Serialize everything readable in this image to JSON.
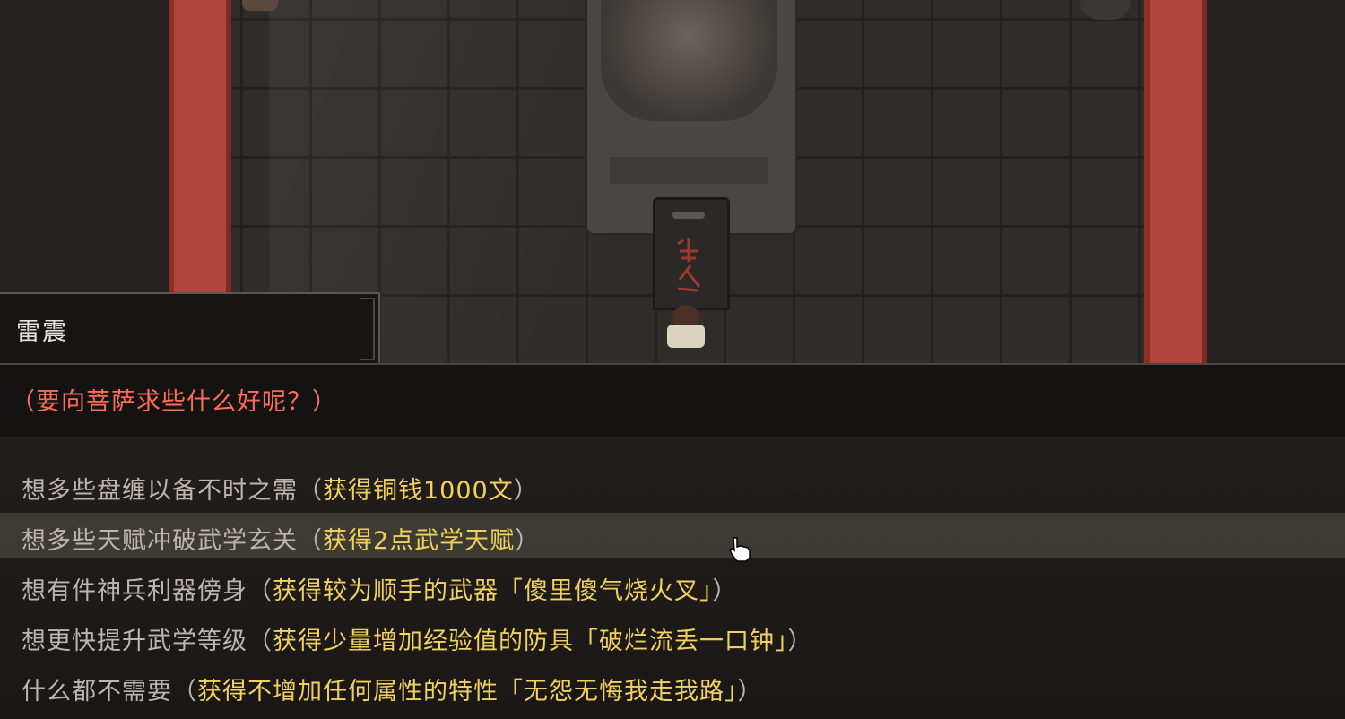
{
  "scene": {
    "player_icon": "player-sprite",
    "shrine_icon": "bodhisattva-shrine"
  },
  "speaker_name": "雷震",
  "dialog": {
    "prompt": "（要向菩萨求些什么好呢？）",
    "color": "#ff6b57"
  },
  "choices": [
    {
      "label": "想多些盘缠以备不时之需",
      "open": "（",
      "reward": "获得铜钱1000文",
      "close": "）",
      "hovered": false
    },
    {
      "label": "想多些天赋冲破武学玄关",
      "open": "（",
      "reward": "获得2点武学天赋",
      "close": "）",
      "hovered": true
    },
    {
      "label": "想有件神兵利器傍身",
      "open": "（",
      "reward": "获得较为顺手的武器「傻里傻气烧火叉」",
      "close": "）",
      "hovered": false
    },
    {
      "label": "想更快提升武学等级",
      "open": "（",
      "reward": "获得少量增加经验值的防具「破烂流丢一口钟」",
      "close": "）",
      "hovered": false
    },
    {
      "label": "什么都不需要",
      "open": "（",
      "reward": "获得不增加任何属性的特性「无怨无悔我走我路」",
      "close": "）",
      "hovered": false
    }
  ],
  "colors": {
    "choice_label": "#bdb6ae",
    "reward": "#f2d25c",
    "pillar": "#b2453b"
  },
  "cursor_icon": "pointing-hand-cursor"
}
